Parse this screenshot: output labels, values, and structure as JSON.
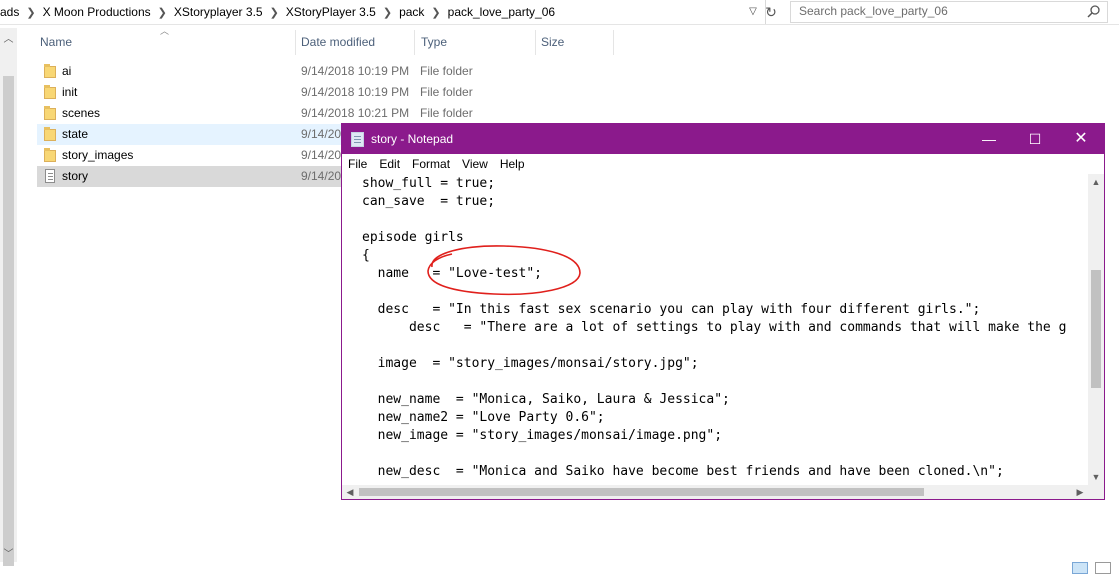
{
  "explorer": {
    "breadcrumb": [
      "ads",
      "X Moon Productions",
      "XStoryplayer 3.5",
      "XStoryPlayer 3.5",
      "pack",
      "pack_love_party_06"
    ],
    "search_placeholder": "Search pack_love_party_06",
    "columns": {
      "name": "Name",
      "date": "Date modified",
      "type": "Type",
      "size": "Size"
    },
    "files": [
      {
        "name": "ai",
        "date": "9/14/2018 10:19 PM",
        "type": "File folder",
        "icon": "folder-icon"
      },
      {
        "name": "init",
        "date": "9/14/2018 10:19 PM",
        "type": "File folder",
        "icon": "folder-icon"
      },
      {
        "name": "scenes",
        "date": "9/14/2018 10:21 PM",
        "type": "File folder",
        "icon": "folder-icon"
      },
      {
        "name": "state",
        "date": "9/14/20",
        "type": "",
        "icon": "folder-icon"
      },
      {
        "name": "story_images",
        "date": "9/14/20",
        "type": "",
        "icon": "folder-icon"
      },
      {
        "name": "story",
        "date": "9/14/20",
        "type": "",
        "icon": "text-file-icon"
      }
    ]
  },
  "notepad": {
    "title": "story - Notepad",
    "menu": [
      "File",
      "Edit",
      "Format",
      "View",
      "Help"
    ],
    "accent": "#8b1a8c",
    "lines": [
      "show_full = true;",
      "can_save  = true;",
      "",
      "episode girls",
      "{",
      "  name   = \"Love-test\";",
      "",
      "  desc   = \"In this fast sex scenario you can play with four different girls.\";",
      "      desc   = \"There are a lot of settings to play with and commands that will make the g",
      "",
      "  image  = \"story_images/monsai/story.jpg\";",
      "",
      "  new_name  = \"Monica, Saiko, Laura & Jessica\";",
      "  new_name2 = \"Love Party 0.6\";",
      "  new_image = \"story_images/monsai/image.png\";",
      "",
      "  new_desc  = \"Monica and Saiko have become best friends and have been cloned.\\n\";"
    ]
  },
  "annotation_color": "#e0201c"
}
